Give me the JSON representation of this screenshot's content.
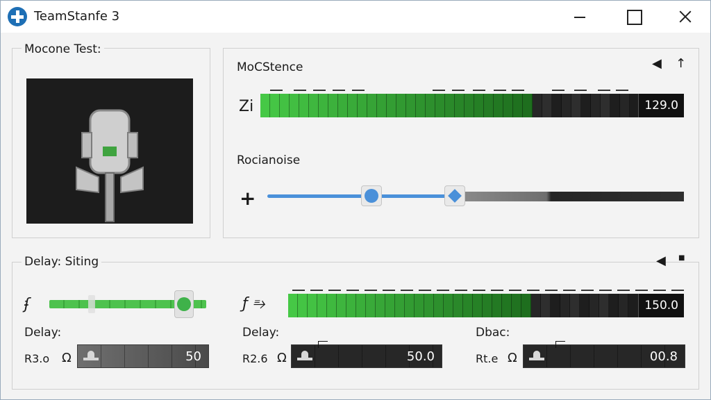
{
  "window": {
    "title": "TeamStanfe 3"
  },
  "mic_panel": {
    "label": "Mocone Test:"
  },
  "mocstence": {
    "label": "MoCStence",
    "left_glyph": "Zi",
    "meter_value": "129.0",
    "level": 0.74
  },
  "rocianoise": {
    "label": "Rocianoise",
    "left_glyph": "+",
    "slider_low": 0.25,
    "slider_high": 0.45
  },
  "delay_panel": {
    "label": "Delay: Siting",
    "left_slider_glyph": "ʄ",
    "green_slider_level": 0.86,
    "meter_glyph": "ƒ ⥱",
    "meter_value": "150.0",
    "meter_level": 0.71,
    "fields": [
      {
        "title": "Delay:",
        "prefix": "R3.o",
        "unit_glyph": "Ω",
        "value": "50"
      },
      {
        "title": "Delay:",
        "prefix": "R2.6",
        "unit_glyph": "Ω",
        "value": "50.0"
      },
      {
        "title": "Dbac:",
        "prefix": "Rt.e",
        "unit_glyph": "Ω",
        "value": "00.8"
      }
    ]
  },
  "colors": {
    "accent_blue": "#4a90d9",
    "meter_green": "#4ec24e",
    "dark": "#1d1d1d"
  }
}
